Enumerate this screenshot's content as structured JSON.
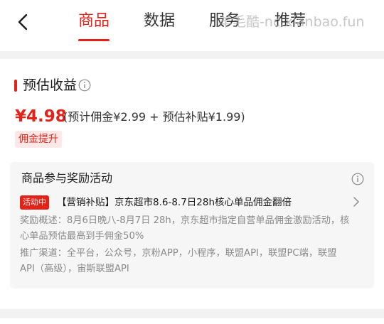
{
  "nav": {
    "back_icon": "chevron-left-icon",
    "tabs": [
      {
        "label": "商品",
        "active": true
      },
      {
        "label": "数据",
        "active": false
      },
      {
        "label": "服务",
        "active": false
      },
      {
        "label": "推荐",
        "active": false
      }
    ],
    "watermark": "羊毛酷-nc.xianbao.fun"
  },
  "earnings": {
    "title": "预估收益",
    "info_icon": "info-circle-icon",
    "total": "¥4.98",
    "breakdown": "(预计佣金¥2.99 + 预估补贴¥1.99)",
    "badge": "佣金提升"
  },
  "promotion": {
    "title": "商品参与奖励活动",
    "info_icon": "info-circle-icon",
    "status": "活动中",
    "activity_name": "【营销补贴】京东超市8.6-8.7日28h核心单品佣金翻倍",
    "overview_lines": [
      "奖励概述：8月6日晚八-8月7日 28h，京东超市指定自营单品佣金激励活动，核",
      "心单品预估最高到手佣金50%"
    ],
    "channel_lines": [
      "推广渠道：全平台，公众号，京粉APP，小程序，联盟API，联盟PC端，联盟",
      "API（高级），宙斯联盟API"
    ],
    "arrow_icon": "chevron-right-icon"
  },
  "colors": {
    "accent": "#e2231a",
    "badge_bg": "#fde8e7",
    "page_bg": "#f2f2f2",
    "promo_bg": "#f6f6f6"
  }
}
